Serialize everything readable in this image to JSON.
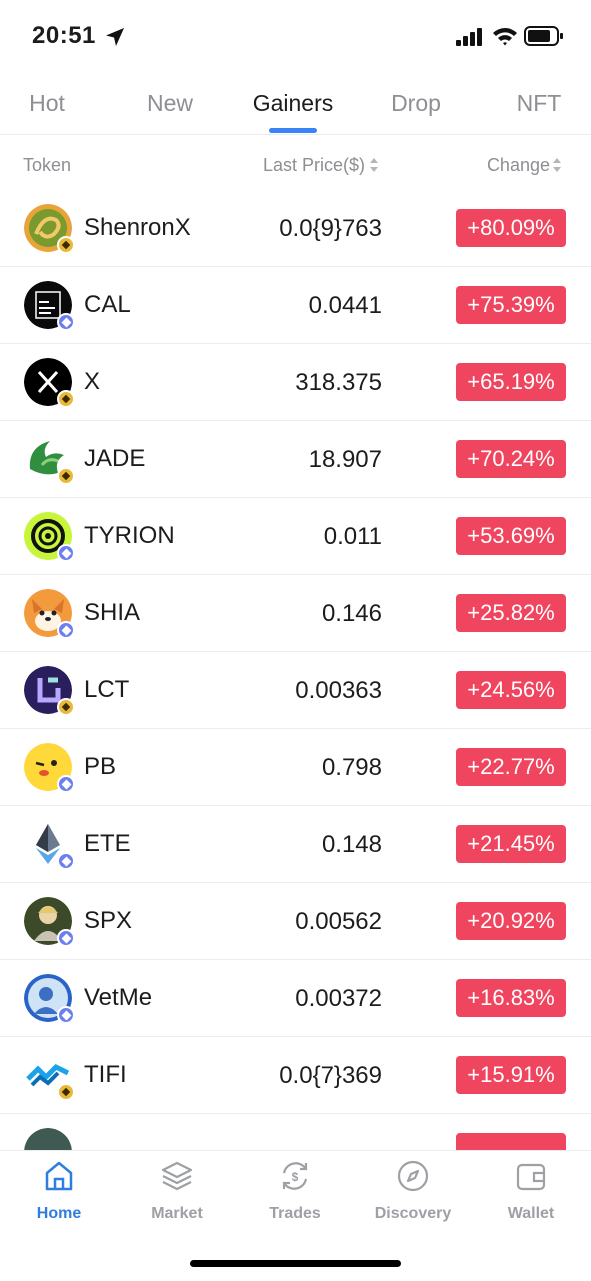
{
  "status_bar": {
    "time": "20:51",
    "icons": [
      "location-arrow-icon",
      "signal-icon",
      "wifi-icon",
      "battery-icon"
    ]
  },
  "tabs": [
    {
      "label": "Hot",
      "active": false
    },
    {
      "label": "New",
      "active": false
    },
    {
      "label": "Gainers",
      "active": true
    },
    {
      "label": "Drop",
      "active": false
    },
    {
      "label": "NFT",
      "active": false
    }
  ],
  "table_header": {
    "token": "Token",
    "last_price": "Last Price($)",
    "change": "Change"
  },
  "tokens": [
    {
      "name": "ShenronX",
      "price": "0.0{9}763",
      "change": "+80.09%",
      "chain": "bnb"
    },
    {
      "name": "CAL",
      "price": "0.0441",
      "change": "+75.39%",
      "chain": "eth"
    },
    {
      "name": "X",
      "price": "318.375",
      "change": "+65.19%",
      "chain": "bnb"
    },
    {
      "name": "JADE",
      "price": "18.907",
      "change": "+70.24%",
      "chain": "bnb"
    },
    {
      "name": "TYRION",
      "price": "0.011",
      "change": "+53.69%",
      "chain": "eth"
    },
    {
      "name": "SHIA",
      "price": "0.146",
      "change": "+25.82%",
      "chain": "eth"
    },
    {
      "name": "LCT",
      "price": "0.00363",
      "change": "+24.56%",
      "chain": "bnb"
    },
    {
      "name": "PB",
      "price": "0.798",
      "change": "+22.77%",
      "chain": "eth"
    },
    {
      "name": "ETE",
      "price": "0.148",
      "change": "+21.45%",
      "chain": "eth"
    },
    {
      "name": "SPX",
      "price": "0.00562",
      "change": "+20.92%",
      "chain": "eth"
    },
    {
      "name": "VetMe",
      "price": "0.00372",
      "change": "+16.83%",
      "chain": "eth"
    },
    {
      "name": "TIFI",
      "price": "0.0{7}369",
      "change": "+15.91%",
      "chain": "bnb"
    }
  ],
  "bottom_nav": [
    {
      "label": "Home",
      "icon": "home-icon",
      "active": true
    },
    {
      "label": "Market",
      "icon": "layers-icon",
      "active": false
    },
    {
      "label": "Trades",
      "icon": "swap-dollar-icon",
      "active": false
    },
    {
      "label": "Discovery",
      "icon": "compass-icon",
      "active": false
    },
    {
      "label": "Wallet",
      "icon": "wallet-icon",
      "active": false
    }
  ],
  "colors": {
    "accent": "#3b82f6",
    "change_badge": "#f0455e",
    "nav_active": "#2f7de1",
    "muted": "#8e8e93"
  }
}
